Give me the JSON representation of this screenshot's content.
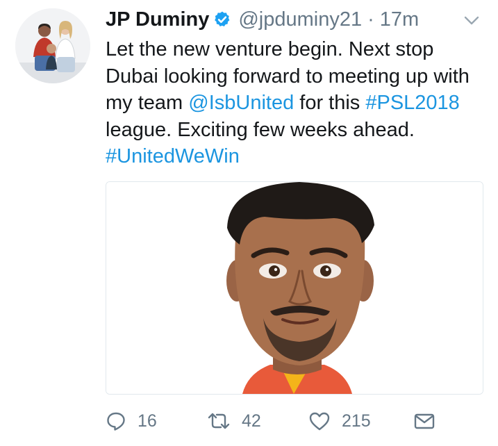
{
  "tweet": {
    "author_name": "JP Duminy",
    "verified_icon": "verified-badge-icon",
    "handle": "@jpduminy21",
    "separator": "·",
    "timestamp": "17m",
    "text": {
      "part1": "Let the new venture begin. Next stop Dubai   looking forward to meeting up with my team ",
      "mention": "@IsbUnited",
      "part2": " for this ",
      "hashtag1": "#PSL2018",
      "part3": " league. Exciting few weeks ahead. ",
      "hashtag2": "#UnitedWeWin"
    }
  },
  "actions": {
    "reply_count": "16",
    "retweet_count": "42",
    "like_count": "215"
  },
  "colors": {
    "link": "#1b95e0",
    "muted": "#657786",
    "verified": "#1da1f2",
    "text": "#14171a"
  }
}
